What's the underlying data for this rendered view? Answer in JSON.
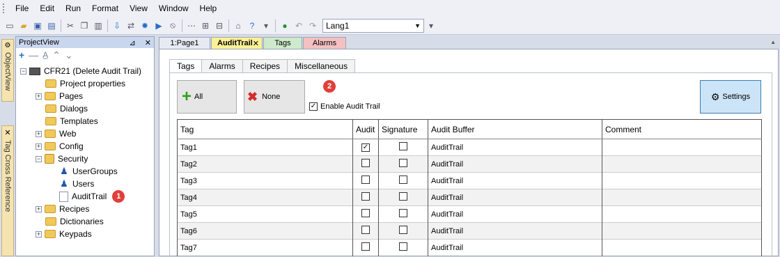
{
  "menu": [
    "File",
    "Edit",
    "Run",
    "Format",
    "View",
    "Window",
    "Help"
  ],
  "toolbar": {
    "language": "Lang1"
  },
  "side_tabs": {
    "object_view": "ObjectView",
    "tag_xref": "Tag Cross Reference"
  },
  "project_view": {
    "title": "ProjectView",
    "root": "CFR21 (Delete Audit Trail)",
    "items": [
      "Project properties",
      "Pages",
      "Dialogs",
      "Templates",
      "Web",
      "Config",
      "Security",
      "UserGroups",
      "Users",
      "AuditTrail",
      "Recipes",
      "Dictionaries",
      "Keypads"
    ],
    "badge": "1"
  },
  "doc_tabs": [
    "1:Page1",
    "AuditTrail",
    "Tags",
    "Alarms"
  ],
  "sub_tabs": [
    "Tags",
    "Alarms",
    "Recipes",
    "Miscellaneous"
  ],
  "buttons": {
    "all": "All",
    "none": "None",
    "settings": "Settings"
  },
  "enable_audit_trail": {
    "label": "Enable Audit Trail",
    "checked": true,
    "badge": "2"
  },
  "grid": {
    "columns": [
      "Tag",
      "Audit",
      "Signature",
      "Audit Buffer",
      "Comment"
    ],
    "rows": [
      {
        "tag": "Tag1",
        "audit": true,
        "signature": false,
        "buffer": "AuditTrail",
        "comment": ""
      },
      {
        "tag": "Tag2",
        "audit": false,
        "signature": false,
        "buffer": "AuditTrail",
        "comment": ""
      },
      {
        "tag": "Tag3",
        "audit": false,
        "signature": false,
        "buffer": "AuditTrail",
        "comment": ""
      },
      {
        "tag": "Tag4",
        "audit": false,
        "signature": false,
        "buffer": "AuditTrail",
        "comment": ""
      },
      {
        "tag": "Tag5",
        "audit": false,
        "signature": false,
        "buffer": "AuditTrail",
        "comment": ""
      },
      {
        "tag": "Tag6",
        "audit": false,
        "signature": false,
        "buffer": "AuditTrail",
        "comment": ""
      },
      {
        "tag": "Tag7",
        "audit": false,
        "signature": false,
        "buffer": "AuditTrail",
        "comment": ""
      }
    ]
  }
}
